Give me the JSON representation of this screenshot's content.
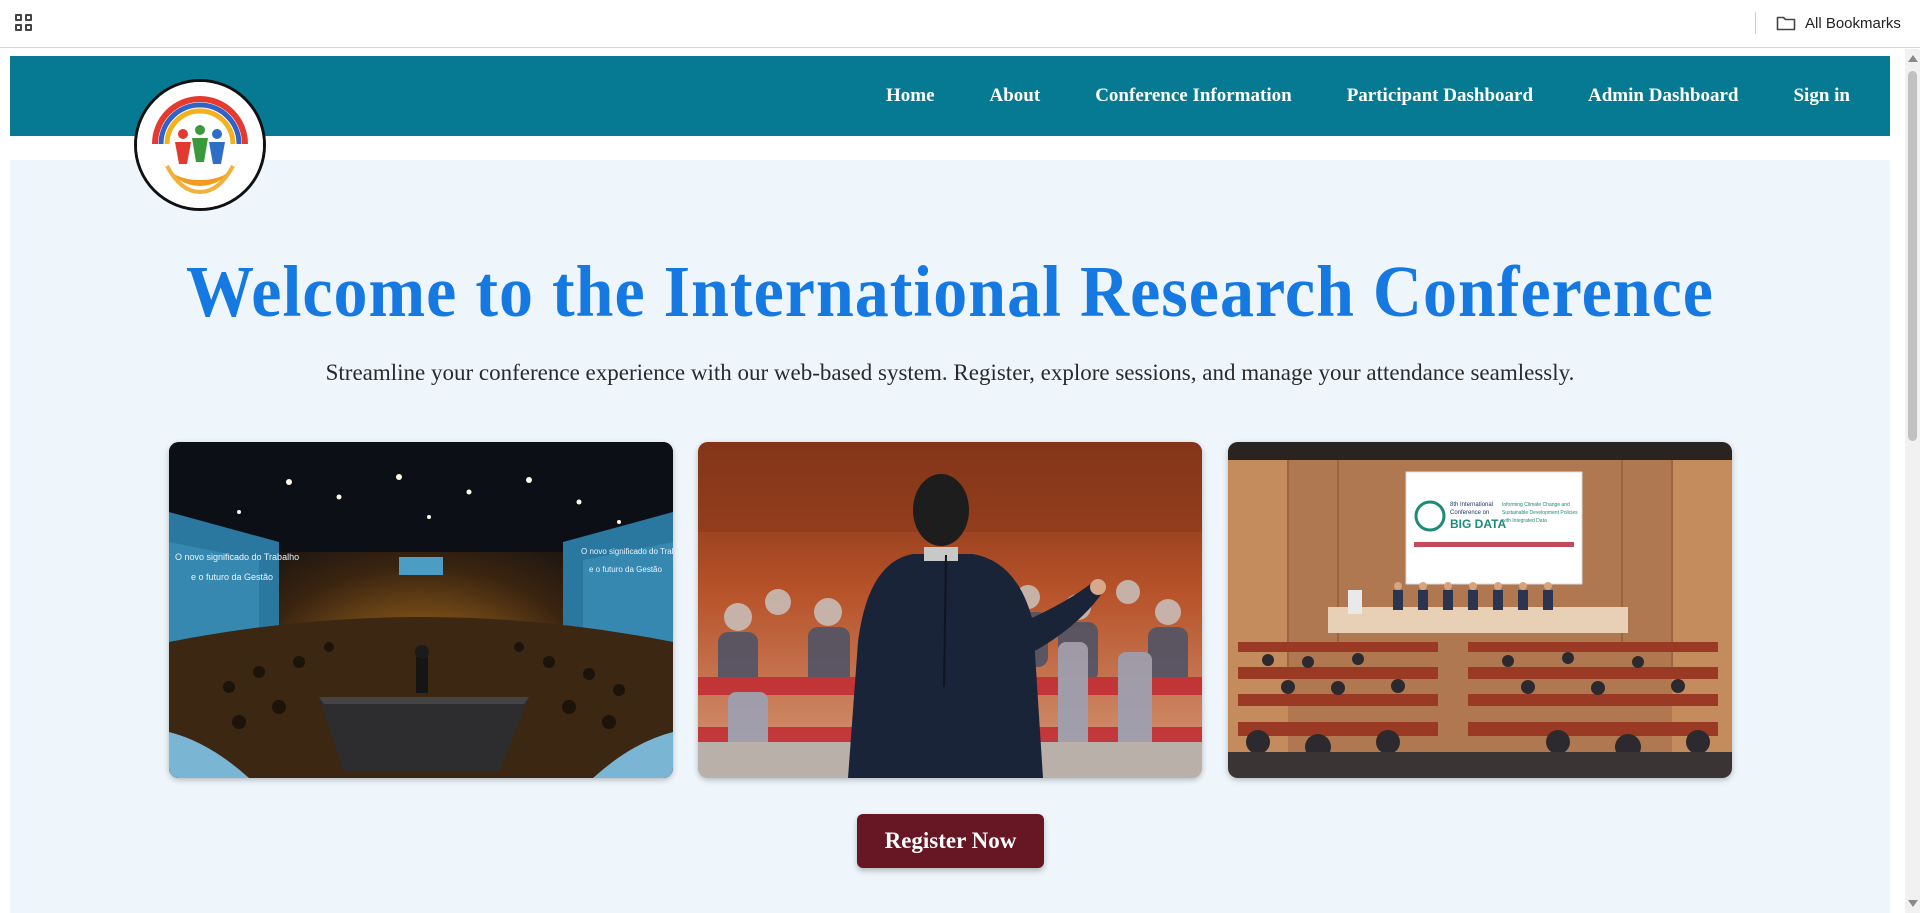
{
  "browser": {
    "bookmarks_label": "All Bookmarks"
  },
  "nav": {
    "items": [
      {
        "label": "Home"
      },
      {
        "label": "About"
      },
      {
        "label": "Conference Information"
      },
      {
        "label": "Participant Dashboard"
      },
      {
        "label": "Admin Dashboard"
      },
      {
        "label": "Sign in"
      }
    ]
  },
  "hero": {
    "title": "Welcome to the International Research Conference",
    "subtitle": "Streamline your conference experience with our web-based system. Register, explore sessions, and manage your attendance seamlessly.",
    "register_label": "Register Now",
    "photos": [
      {
        "name": "conference-hall-photo",
        "screen_left": "O novo significado do Trabalho",
        "screen_left2": "e o futuro da Gestão",
        "screen_right": "O novo significado do Trabalho",
        "screen_right2": "e o futuro da Gestão"
      },
      {
        "name": "speaker-audience-photo"
      },
      {
        "name": "panel-auditorium-photo",
        "slide_line1": "8th International",
        "slide_line2": "Conference on",
        "slide_big": "BIG DATA",
        "slide_right1": "Informing Climate Change and",
        "slide_right2": "Sustainable Development Policies",
        "slide_right3": "with Integrated Data"
      }
    ]
  },
  "colors": {
    "nav_bg": "#077a93",
    "hero_bg": "#eef6fc",
    "title": "#1579e1",
    "button": "#671623"
  },
  "icons": [
    "apps-grid-icon",
    "folder-icon"
  ]
}
